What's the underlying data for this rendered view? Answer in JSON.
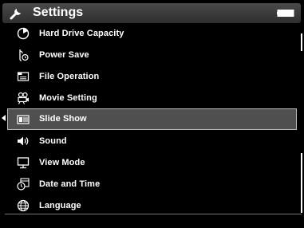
{
  "window": {
    "title": "Settings"
  },
  "menu": {
    "items": [
      {
        "label": "Hard Drive Capacity",
        "icon": "pie-chart-icon"
      },
      {
        "label": "Power Save",
        "icon": "power-save-icon"
      },
      {
        "label": "File Operation",
        "icon": "file-operation-icon"
      },
      {
        "label": "Movie Setting",
        "icon": "movie-camera-icon"
      },
      {
        "label": "Slide Show",
        "icon": "slide-show-icon",
        "selected": true
      },
      {
        "label": "Sound",
        "icon": "speaker-icon"
      },
      {
        "label": "View Mode",
        "icon": "monitor-icon"
      },
      {
        "label": "Date and Time",
        "icon": "clock-icon"
      },
      {
        "label": "Language",
        "icon": "globe-icon"
      }
    ]
  },
  "colors": {
    "titlebar": "#3c3c3c",
    "selection": "#4f4f4f",
    "text": "#ffffff",
    "background": "#000000"
  }
}
